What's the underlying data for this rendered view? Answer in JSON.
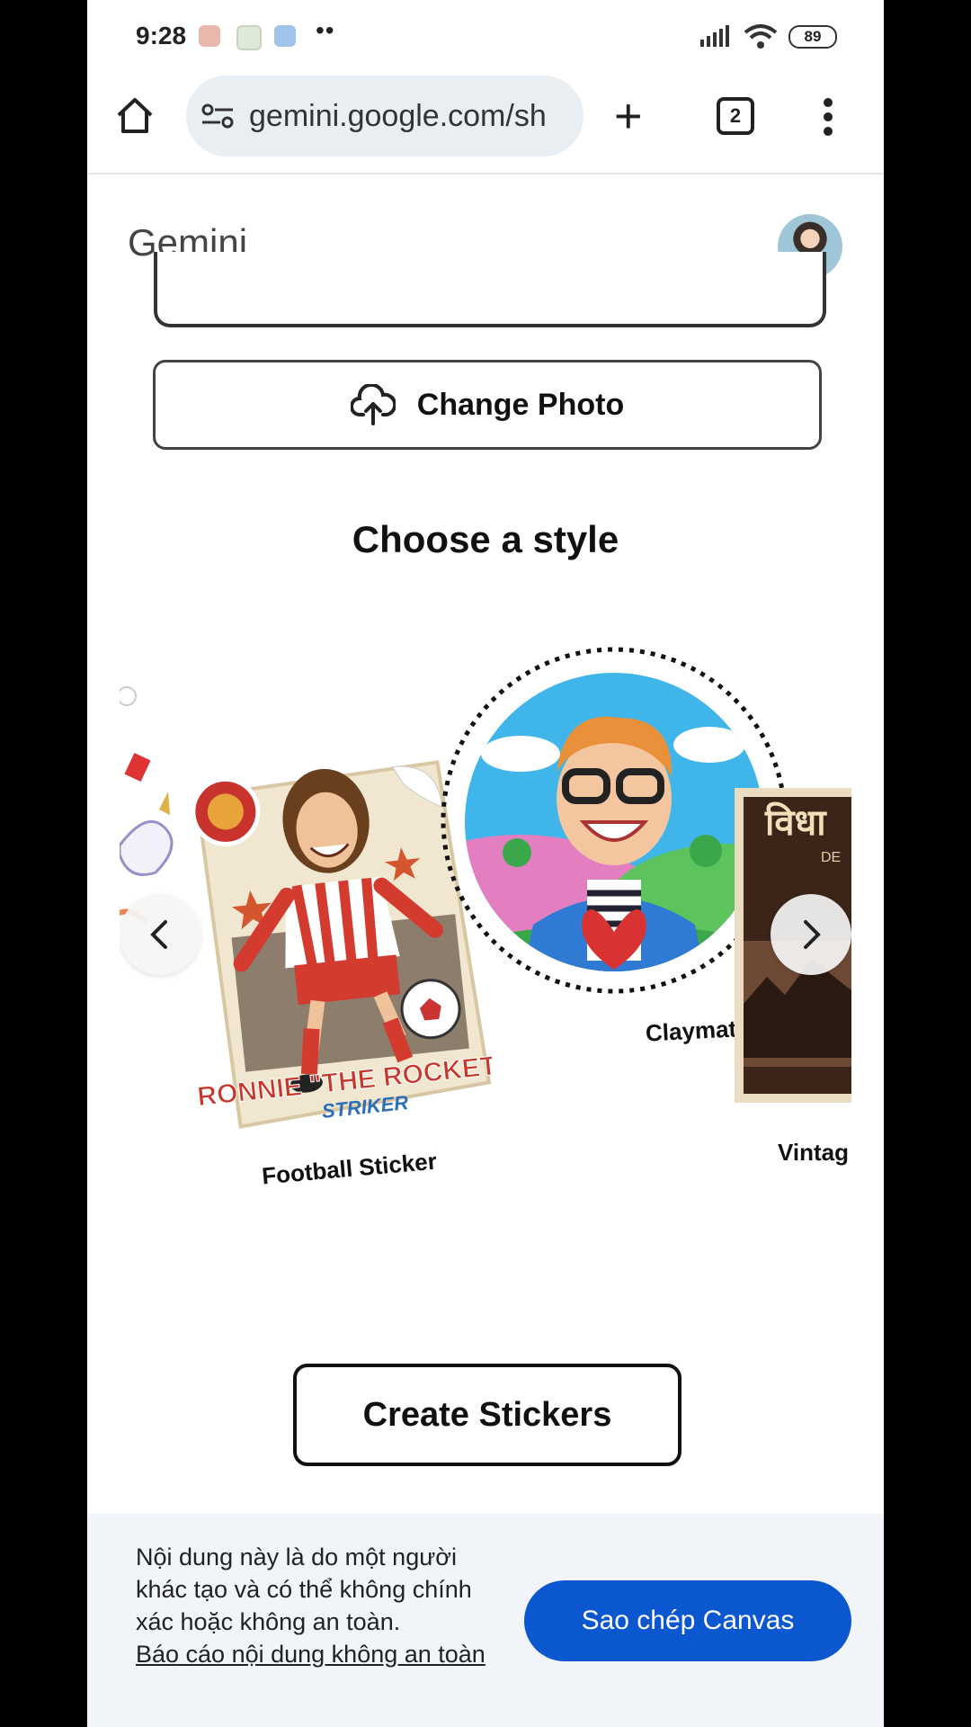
{
  "status_bar": {
    "time": "9:28",
    "battery": "89"
  },
  "browser": {
    "url": "gemini.google.com/sh",
    "tab_count": "2"
  },
  "header": {
    "title": "Gemini"
  },
  "actions": {
    "change_photo": "Change Photo",
    "create_stickers": "Create Stickers"
  },
  "style_section": {
    "heading": "Choose a style",
    "styles": [
      {
        "label": "Football Sticker",
        "art_text": "RONNIE \"THE ROCKET\"",
        "art_subtext": "STRIKER"
      },
      {
        "label": "Claymation",
        "selected": true
      },
      {
        "label": "Vintag",
        "art_text": "विधा",
        "art_subtext": "DE"
      }
    ]
  },
  "footer": {
    "notice": "Nội dung này là do một người khác tạo và có thể không chính xác hoặc không an toàn.",
    "report_link": "Báo cáo nội dung không an toàn",
    "copy_button": "Sao chép Canvas"
  },
  "colors": {
    "primary_button": "#0b57d0",
    "footer_bg": "#f1f5fa"
  }
}
